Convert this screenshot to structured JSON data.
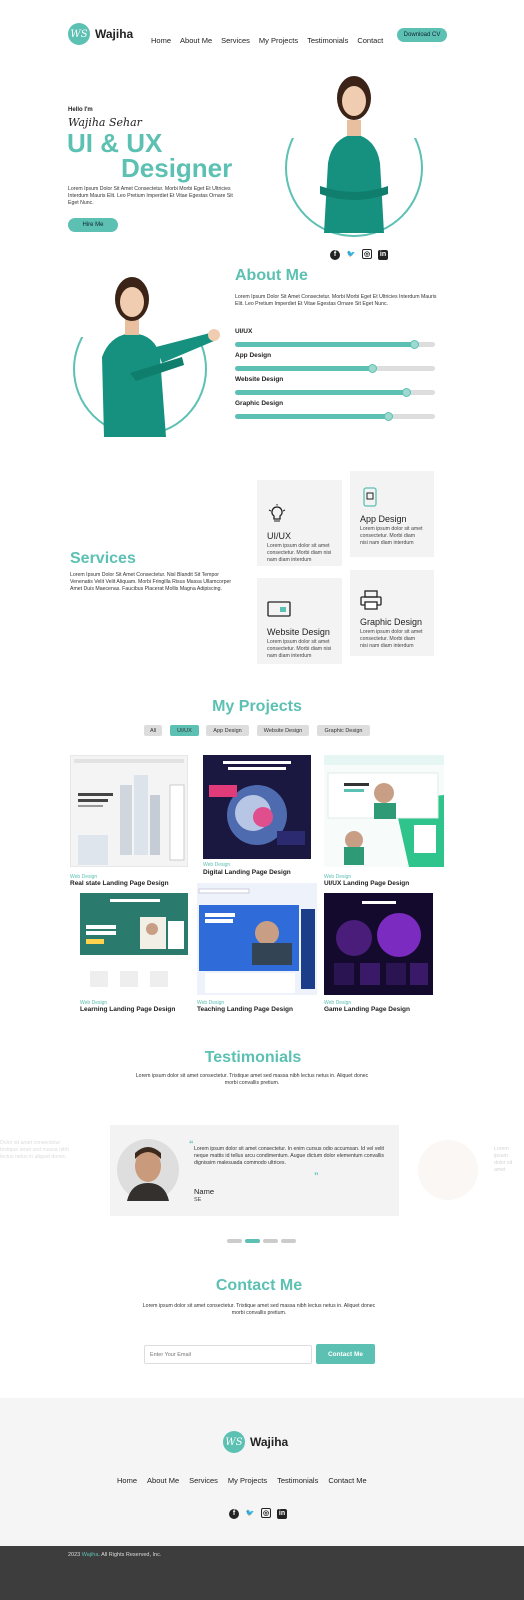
{
  "header": {
    "logo_mark": "WS",
    "logo_text": "Wajiha",
    "nav": [
      "Home",
      "About Me",
      "Services",
      "My Projects",
      "Testimonials",
      "Contact"
    ],
    "cta": "Download CV"
  },
  "hero": {
    "greeting": "Hello I'm",
    "name": "Wajiha Sehar",
    "title_line1": "UI & UX",
    "title_line2": "Designer",
    "description": "Lorem Ipsum Dolor Sit Amet Consectetur. Morbi Morbi Eget Et Ultricies Interdum Mauris Elit. Leo Pretium Imperdiet Et Vitae Egestas Ornare Sit Eget Nunc.",
    "button": "Hire Me"
  },
  "about": {
    "heading": "About Me",
    "description": "Lorem Ipsum Dolor Sit Amet Consectetur. Morbi Morbi Eget Et Ultricies Interdum Mauris Elit. Leo Pretium Imperdiet Et Vitae Egestas Ornare Sit Eget Nunc.",
    "skills": [
      {
        "label": "UI/UX",
        "level": 0.9
      },
      {
        "label": "App Design",
        "level": 0.69
      },
      {
        "label": "Website Design",
        "level": 0.86
      },
      {
        "label": "Graphic Design",
        "level": 0.77
      }
    ]
  },
  "services": {
    "heading": "Services",
    "description": "Lorem Ipsum Dolor Sit Amet Consectetur. Nisl Blandit Sit Tempor Venenatis Velit Velit Aliquam. Morbi Fringilla Risus Massa Ullamcorper Amet Duis Maecenas. Faucibus Placerat Mollis Magna Adipiscing.",
    "cards": [
      {
        "title": "UI/UX",
        "text": "Lorem ipsum dolor sit amet consectetur. Morbi diam nisi nam diam interdum",
        "icon": "lightbulb-icon"
      },
      {
        "title": "App Design",
        "text": "Lorem ipsum dolor sit amet consectetur. Morbi diam nisi nam diam interdum",
        "icon": "phone-icon"
      },
      {
        "title": "Website Design",
        "text": "Lorem ipsum dolor sit amet consectetur. Morbi diam nisi nam diam interdum",
        "icon": "monitor-icon"
      },
      {
        "title": "Graphic Design",
        "text": "Lorem ipsum dolor sit amet consectetur. Morbi diam nisi nam diam interdum",
        "icon": "printer-icon"
      }
    ]
  },
  "projects": {
    "heading": "My Projects",
    "filters": [
      "All",
      "UI/UX",
      "App Design",
      "Website Design",
      "Graphic Design"
    ],
    "active_filter": "UI/UX",
    "items": [
      {
        "category": "Web Design",
        "title": "Real state Landing Page Design"
      },
      {
        "category": "Web Design",
        "title": "Digital Landing Page Design"
      },
      {
        "category": "Web Design",
        "title": "UI/UX Landing Page Design"
      },
      {
        "category": "Web Design",
        "title": "Learning Landing Page Design"
      },
      {
        "category": "Web Design",
        "title": "Teaching Landing Page Design"
      },
      {
        "category": "Web Design",
        "title": "Game Landing Page Design"
      }
    ]
  },
  "testimonials": {
    "heading": "Testimonials",
    "description": "Lorem ipsum dolor sit amet consectetur. Tristique amet sed massa nibh lectus netus in. Aliquet donec morbi convallis pretium.",
    "quote": "Lorem ipsum dolor sit amet consectetur. In enim cursus odio accumsan. Id vel velit neque mattis id tellus arcu condimentum. Augue dictum dolor elementum convallis dignissim malesuada commodo ultrices.",
    "name": "Name",
    "role": "SE"
  },
  "contact": {
    "heading": "Contact Me",
    "description": "Lorem ipsum dolor sit amet consectetur. Tristique amet sed massa nibh lectus netus in. Aliquet donec morbi convallis pretium.",
    "email_placeholder": "Enter Your Email",
    "button": "Contact Me"
  },
  "footer": {
    "logo_mark": "WS",
    "logo_text": "Wajiha",
    "nav": [
      "Home",
      "About Me",
      "Services",
      "My Projects",
      "Testimonials",
      "Contact Me"
    ],
    "copyright_year": "2023",
    "copyright_name": "Wajiha",
    "copyright_rest": ". All Rights Reserved, Inc."
  },
  "colors": {
    "accent": "#5cc0b3",
    "footer_bar": "#3d3d3d",
    "footer_bg": "#f5f5f5"
  }
}
